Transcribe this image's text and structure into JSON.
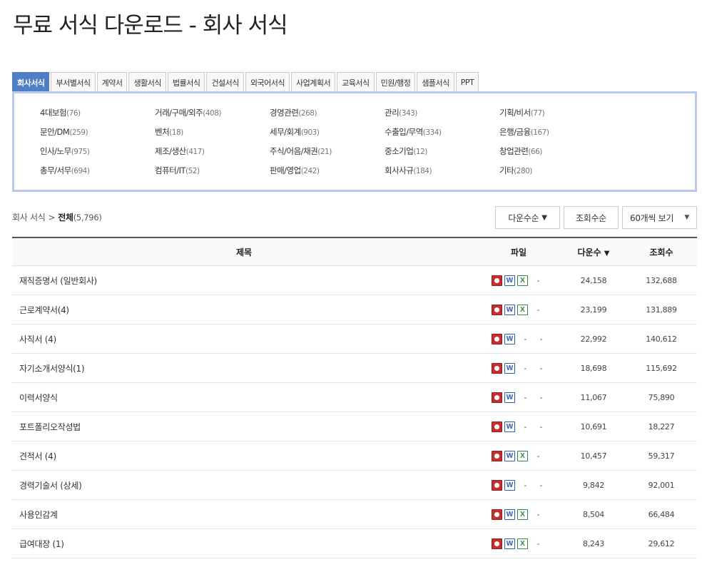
{
  "page": {
    "title": "무료 서식 다운로드 - 회사 서식"
  },
  "tabs": [
    "회사서식",
    "부서별서식",
    "계약서",
    "생활서식",
    "법률서식",
    "건설서식",
    "외국어서식",
    "사업계획서",
    "교육서식",
    "민원/행정",
    "샘플서식",
    "PPT"
  ],
  "categories": [
    {
      "name": "4대보험",
      "count": "(76)"
    },
    {
      "name": "거래/구매/외주",
      "count": "(408)"
    },
    {
      "name": "경영관련",
      "count": "(268)"
    },
    {
      "name": "관리",
      "count": "(343)"
    },
    {
      "name": "기획/비서",
      "count": "(77)"
    },
    {
      "name": "문안/DM",
      "count": "(259)"
    },
    {
      "name": "벤처",
      "count": "(18)"
    },
    {
      "name": "세무/회계",
      "count": "(903)"
    },
    {
      "name": "수출입/무역",
      "count": "(334)"
    },
    {
      "name": "은행/금융",
      "count": "(167)"
    },
    {
      "name": "인사/노무",
      "count": "(975)"
    },
    {
      "name": "제조/생산",
      "count": "(417)"
    },
    {
      "name": "주식/어음/채권",
      "count": "(21)"
    },
    {
      "name": "중소기업",
      "count": "(12)"
    },
    {
      "name": "창업관련",
      "count": "(66)"
    },
    {
      "name": "총무/서무",
      "count": "(694)"
    },
    {
      "name": "컴퓨터/IT",
      "count": "(52)"
    },
    {
      "name": "판매/영업",
      "count": "(242)"
    },
    {
      "name": "회사사규",
      "count": "(184)"
    },
    {
      "name": "기타",
      "count": "(280)"
    }
  ],
  "breadcrumb": {
    "parent": "회사 서식",
    "separator": ">",
    "current": "전체",
    "total": "(5,796)"
  },
  "toolbar": {
    "sort_download": "다운수순",
    "sort_arrow": "▼",
    "sort_views": "조회수순",
    "page_size": "60개씩 보기",
    "chevron": "▼"
  },
  "table": {
    "headers": {
      "title": "제목",
      "file": "파일",
      "downloads": "다운수",
      "downloads_arrow": "▼",
      "views": "조회수"
    },
    "rows": [
      {
        "title": "재직증명서 (일반회사)",
        "files": [
          "hwp",
          "doc",
          "xls"
        ],
        "downloads": "24,158",
        "views": "132,688"
      },
      {
        "title": "근로계약서(4)",
        "files": [
          "hwp",
          "doc",
          "xls"
        ],
        "downloads": "23,199",
        "views": "131,889"
      },
      {
        "title": "사직서 (4)",
        "files": [
          "hwp",
          "doc"
        ],
        "downloads": "22,992",
        "views": "140,612"
      },
      {
        "title": "자기소개서양식(1)",
        "files": [
          "hwp",
          "doc"
        ],
        "downloads": "18,698",
        "views": "115,692"
      },
      {
        "title": "이력서양식",
        "files": [
          "hwp",
          "doc"
        ],
        "downloads": "11,067",
        "views": "75,890"
      },
      {
        "title": "포트폴리오작성법",
        "files": [
          "hwp",
          "doc"
        ],
        "downloads": "10,691",
        "views": "18,227"
      },
      {
        "title": "견적서 (4)",
        "files": [
          "hwp",
          "doc",
          "xls"
        ],
        "downloads": "10,457",
        "views": "59,317"
      },
      {
        "title": "경력기술서 (상세)",
        "files": [
          "hwp",
          "doc"
        ],
        "downloads": "9,842",
        "views": "92,001"
      },
      {
        "title": "사용인감계",
        "files": [
          "hwp",
          "doc",
          "xls"
        ],
        "downloads": "8,504",
        "views": "66,484"
      },
      {
        "title": "급여대장 (1)",
        "files": [
          "hwp",
          "doc",
          "xls"
        ],
        "downloads": "8,243",
        "views": "29,612"
      }
    ]
  },
  "file_icons": {
    "hwp": "hwp-file-icon",
    "doc": "word-file-icon",
    "xls": "excel-file-icon"
  },
  "file_letters": {
    "doc": "W",
    "xls": "X"
  },
  "dash": "-",
  "colors": {
    "active_tab": "#4f7ec7",
    "panel_border": "#b9c9ee",
    "hwp": "#c62f2f",
    "word": "#2a5cb8",
    "excel": "#2f8a3a"
  }
}
